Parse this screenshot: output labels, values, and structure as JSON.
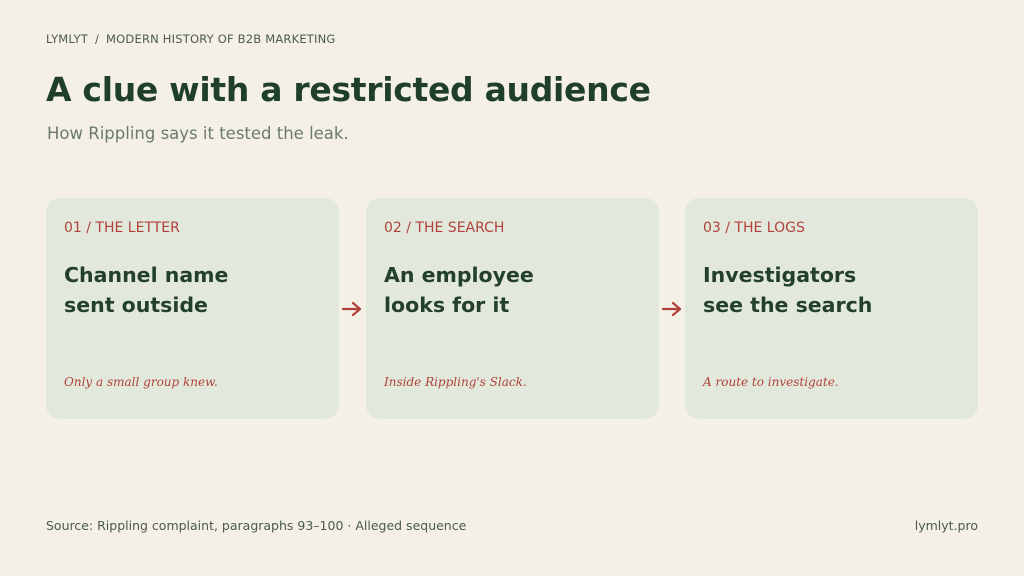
{
  "breadcrumb": {
    "brand": "LYMLYT",
    "separator": "/",
    "section": "MODERN HISTORY OF B2B MARKETING"
  },
  "title": "A clue with a restricted audience",
  "subtitle": "How Rippling says it tested the leak.",
  "steps": [
    {
      "label": "01 / THE LETTER",
      "heading_line1": "Channel name",
      "heading_line2": "sent outside",
      "note": "Only a small group knew."
    },
    {
      "label": "02 / THE SEARCH",
      "heading_line1": "An employee",
      "heading_line2": "looks for it",
      "note": "Inside Rippling's Slack."
    },
    {
      "label": "03 / THE LOGS",
      "heading_line1": "Investigators",
      "heading_line2": "see the search",
      "note": "A route to investigate."
    }
  ],
  "footer": {
    "source": "Source: Rippling complaint, paragraphs 93–100 · Alleged sequence",
    "site": "lymlyt.pro"
  },
  "icons": {
    "connector": "arrow-right-icon"
  },
  "colors": {
    "background": "#f4f0e6",
    "card": "#e2e8dc",
    "accent": "#b0423a",
    "ink": "#23402c"
  }
}
